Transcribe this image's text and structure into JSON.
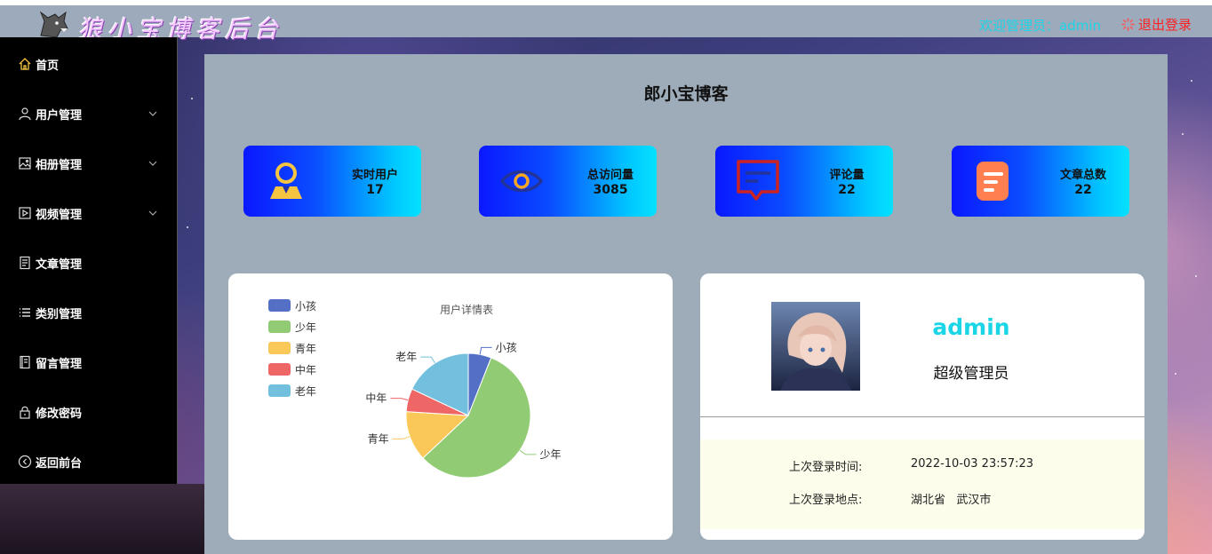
{
  "header": {
    "brand": "狼小宝博客后台",
    "welcome": "欢迎管理员：admin",
    "logout_label": "退出登录",
    "logout_icon": "gear-icon"
  },
  "sidebar": {
    "items": [
      {
        "label": "首页",
        "icon": "home-icon",
        "active": true
      },
      {
        "label": "用户管理",
        "icon": "user-icon",
        "expandable": true
      },
      {
        "label": "相册管理",
        "icon": "image-icon",
        "expandable": true
      },
      {
        "label": "视频管理",
        "icon": "video-icon",
        "expandable": true
      },
      {
        "label": "文章管理",
        "icon": "document-icon"
      },
      {
        "label": "类别管理",
        "icon": "list-icon"
      },
      {
        "label": "留言管理",
        "icon": "notebook-icon"
      },
      {
        "label": "修改密码",
        "icon": "lock-icon"
      },
      {
        "label": "返回前台",
        "icon": "back-icon"
      }
    ]
  },
  "main": {
    "title": "郎小宝博客",
    "stats": [
      {
        "label": "实时用户",
        "value": "17",
        "icon": "user-avatar-icon"
      },
      {
        "label": "总访问量",
        "value": "3085",
        "icon": "eye-icon"
      },
      {
        "label": "评论量",
        "value": "22",
        "icon": "comment-icon"
      },
      {
        "label": "文章总数",
        "value": "22",
        "icon": "article-icon"
      }
    ]
  },
  "chart_data": {
    "type": "pie",
    "title": "用户详情表",
    "legend_position": "top-left",
    "categories": [
      "小孩",
      "少年",
      "青年",
      "中年",
      "老年"
    ],
    "values": [
      6,
      57,
      13,
      6,
      18
    ],
    "colors": [
      "#5470c6",
      "#91cc75",
      "#fac858",
      "#ee6666",
      "#73c0de"
    ]
  },
  "profile": {
    "name": "admin",
    "role": "超级管理员",
    "last_login_time_label": "上次登录时间:",
    "last_login_time": "2022-10-03 23:57:23",
    "last_login_place_label": "上次登录地点:",
    "last_login_place": "湖北省   武汉市"
  },
  "colors": {
    "accent_cyan": "#19d5e6",
    "logout_red": "#ff2222",
    "panel": "#9eacba"
  }
}
